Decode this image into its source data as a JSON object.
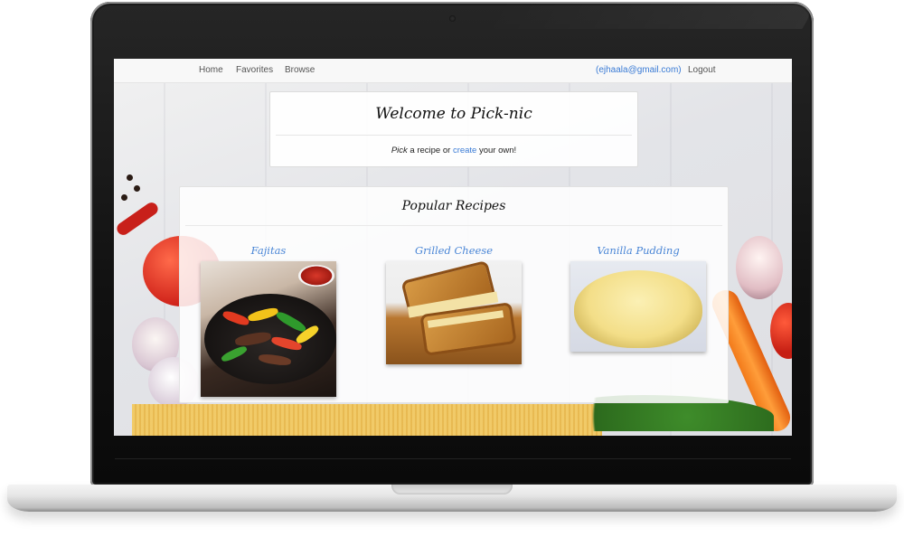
{
  "nav": {
    "home": "Home",
    "favorites": "Favorites",
    "browse": "Browse",
    "email": "(ejhaala@gmail.com)",
    "logout": "Logout"
  },
  "welcome": {
    "title": "Welcome to Pick-nic",
    "subtitle_pick": "Pick",
    "subtitle_mid": " a recipe or ",
    "subtitle_create": "create",
    "subtitle_end": " your own!"
  },
  "popular": {
    "title": "Popular Recipes",
    "recipes": [
      {
        "name": "Fajitas"
      },
      {
        "name": "Grilled Cheese"
      },
      {
        "name": "Vanilla Pudding"
      }
    ]
  },
  "colors": {
    "link": "#3a7bd5",
    "recipe_title": "#4a86d6"
  }
}
